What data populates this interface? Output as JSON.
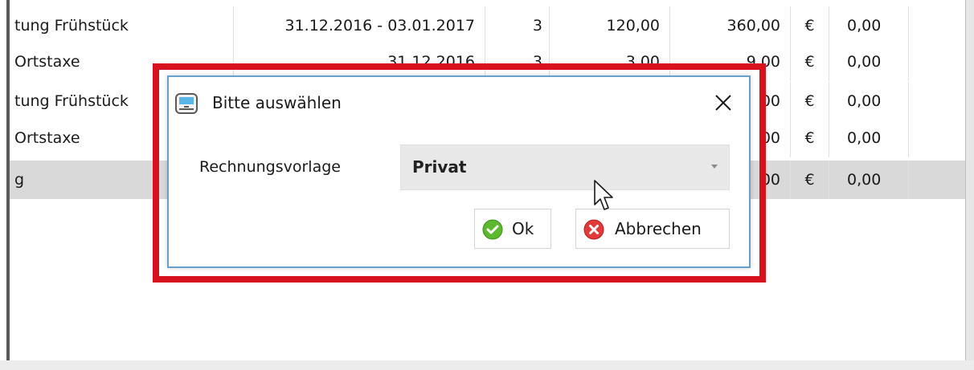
{
  "table": {
    "rows": [
      {
        "name": "tung Frühstück",
        "date": "31.12.2016 - 03.01.2017",
        "qty": "3",
        "price": "120,00",
        "total": "360,00",
        "currency": "€",
        "vat": "0,00"
      },
      {
        "name": "Ortstaxe",
        "date": "31.12.2016",
        "qty": "3",
        "price": "3,00",
        "total": "9,00",
        "currency": "€",
        "vat": "0,00"
      },
      {
        "name": "tung Frühstück",
        "date": "",
        "qty": "",
        "price": "",
        "total": "00",
        "currency": "€",
        "vat": "0,00"
      },
      {
        "name": "Ortstaxe",
        "date": "",
        "qty": "",
        "price": "",
        "total": "00",
        "currency": "€",
        "vat": "0,00"
      },
      {
        "name": "g",
        "date": "",
        "qty": "",
        "price": "",
        "total": "00",
        "currency": "€",
        "vat": "0,00"
      }
    ]
  },
  "dialog": {
    "title": "Bitte auswählen",
    "field_label": "Rechnungsvorlage",
    "select_value": "Privat",
    "ok_label": "Ok",
    "cancel_label": "Abbrechen"
  },
  "colors": {
    "highlight": "#d7121e",
    "dialog_border": "#6a9fc9",
    "total_row": "#d9d9d9",
    "ok_icon": "#5cb82e",
    "cancel_icon": "#e23a3a"
  },
  "icons": {
    "dialog": "window-icon",
    "close": "close-icon",
    "ok": "check-circle-icon",
    "cancel": "x-circle-icon",
    "select": "chevron-down-icon",
    "cursor": "mouse-pointer-icon"
  }
}
